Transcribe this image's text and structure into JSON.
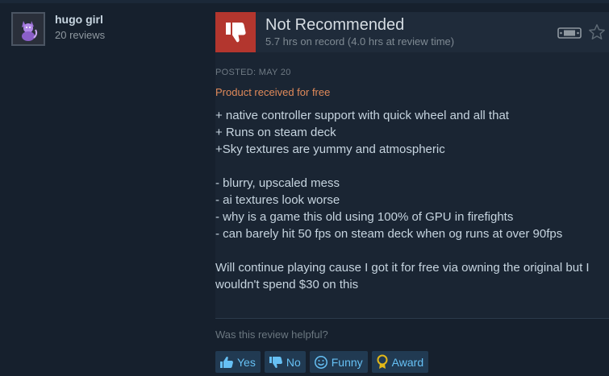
{
  "user": {
    "name": "hugo girl",
    "reviews": "20 reviews"
  },
  "review": {
    "verdict": "Not Recommended",
    "hours": "5.7 hrs on record (4.0 hrs at review time)",
    "posted": "POSTED: MAY 20",
    "free_note": "Product received for free",
    "lines": [
      "+ native controller support with quick wheel and all that",
      "+ Runs on steam deck",
      "+Sky textures are yummy and atmospheric",
      "",
      "- blurry, upscaled mess",
      "- ai textures look worse",
      "- why is a game this old using 100% of GPU in firefights",
      "- can barely hit 50 fps on steam deck when og runs at over 90fps",
      "",
      "Will continue playing cause I got it for free via owning the original but I wouldn't spend $30 on this"
    ]
  },
  "helpful": {
    "question": "Was this review helpful?",
    "yes": "Yes",
    "no": "No",
    "funny": "Funny",
    "award": "Award"
  },
  "icons": {
    "thumb": "thumbs-down-icon",
    "deck": "steam-deck-icon",
    "star": "star-outline-icon"
  },
  "colors": {
    "background": "#16202d",
    "thumb_bg": "#b3362e",
    "link": "#66c0f4",
    "free_note": "#e18a5a"
  }
}
